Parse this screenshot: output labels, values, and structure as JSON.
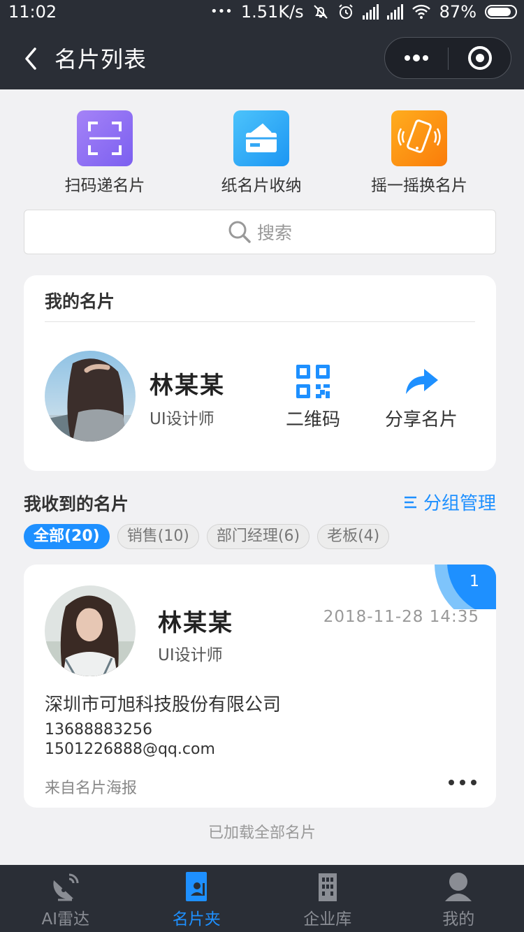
{
  "status_bar": {
    "time": "11:02",
    "dots": "•••",
    "speed": "1.51K/s",
    "battery": "87%",
    "battery_level": 0.87
  },
  "nav": {
    "title": "名片列表"
  },
  "quick_actions": [
    {
      "label": "扫码递名片",
      "icon": "scan-icon",
      "color": "#8a6bf3"
    },
    {
      "label": "纸名片收纳",
      "icon": "card-holder-icon",
      "color": "#22a7f5"
    },
    {
      "label": "摇一摇换名片",
      "icon": "shake-phone-icon",
      "color": "#fb8e10"
    }
  ],
  "search": {
    "placeholder": "搜索"
  },
  "my_card": {
    "title": "我的名片",
    "name": "林某某",
    "job": "UI设计师",
    "qr_label": "二维码",
    "share_label": "分享名片"
  },
  "received": {
    "title": "我收到的名片",
    "group_manage": "分组管理",
    "chips": [
      "全部(20)",
      "销售(10)",
      "部门经理(6)",
      "老板(4)"
    ],
    "card": {
      "badge": "1",
      "name": "林某某",
      "job": "UI设计师",
      "date": "2018-11-28 14:35",
      "company": "深圳市可旭科技股份有限公司",
      "phone": "13688883256",
      "email": "1501226888@qq.com",
      "source": "来自名片海报"
    },
    "loaded_text": "已加载全部名片"
  },
  "tabbar": [
    {
      "label": "AI雷达",
      "icon": "radar-icon",
      "active": false
    },
    {
      "label": "名片夹",
      "icon": "card-folder-icon",
      "active": true
    },
    {
      "label": "企业库",
      "icon": "building-icon",
      "active": false
    },
    {
      "label": "我的",
      "icon": "user-icon",
      "active": false
    }
  ],
  "colors": {
    "accent": "#1e90ff",
    "nav_bg": "#2a2e36",
    "page_bg": "#f1f1f3"
  }
}
